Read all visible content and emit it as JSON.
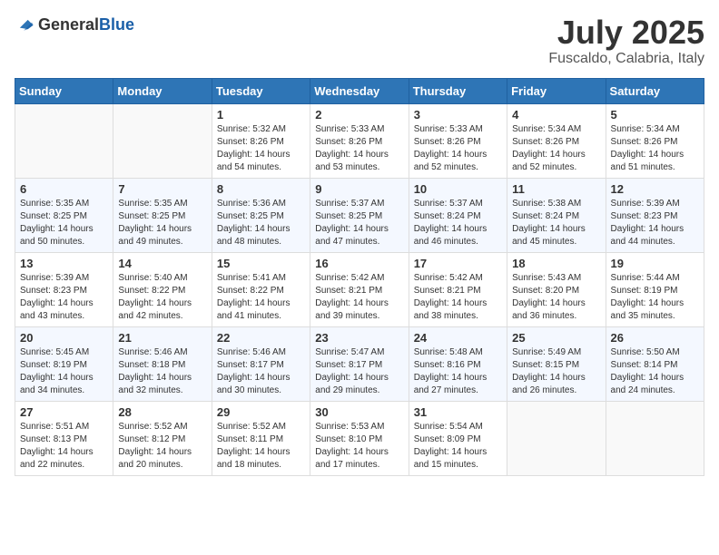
{
  "header": {
    "logo_general": "General",
    "logo_blue": "Blue",
    "month_year": "July 2025",
    "location": "Fuscaldo, Calabria, Italy"
  },
  "weekdays": [
    "Sunday",
    "Monday",
    "Tuesday",
    "Wednesday",
    "Thursday",
    "Friday",
    "Saturday"
  ],
  "weeks": [
    [
      {
        "day": "",
        "sunrise": "",
        "sunset": "",
        "daylight": ""
      },
      {
        "day": "",
        "sunrise": "",
        "sunset": "",
        "daylight": ""
      },
      {
        "day": "1",
        "sunrise": "Sunrise: 5:32 AM",
        "sunset": "Sunset: 8:26 PM",
        "daylight": "Daylight: 14 hours and 54 minutes."
      },
      {
        "day": "2",
        "sunrise": "Sunrise: 5:33 AM",
        "sunset": "Sunset: 8:26 PM",
        "daylight": "Daylight: 14 hours and 53 minutes."
      },
      {
        "day": "3",
        "sunrise": "Sunrise: 5:33 AM",
        "sunset": "Sunset: 8:26 PM",
        "daylight": "Daylight: 14 hours and 52 minutes."
      },
      {
        "day": "4",
        "sunrise": "Sunrise: 5:34 AM",
        "sunset": "Sunset: 8:26 PM",
        "daylight": "Daylight: 14 hours and 52 minutes."
      },
      {
        "day": "5",
        "sunrise": "Sunrise: 5:34 AM",
        "sunset": "Sunset: 8:26 PM",
        "daylight": "Daylight: 14 hours and 51 minutes."
      }
    ],
    [
      {
        "day": "6",
        "sunrise": "Sunrise: 5:35 AM",
        "sunset": "Sunset: 8:25 PM",
        "daylight": "Daylight: 14 hours and 50 minutes."
      },
      {
        "day": "7",
        "sunrise": "Sunrise: 5:35 AM",
        "sunset": "Sunset: 8:25 PM",
        "daylight": "Daylight: 14 hours and 49 minutes."
      },
      {
        "day": "8",
        "sunrise": "Sunrise: 5:36 AM",
        "sunset": "Sunset: 8:25 PM",
        "daylight": "Daylight: 14 hours and 48 minutes."
      },
      {
        "day": "9",
        "sunrise": "Sunrise: 5:37 AM",
        "sunset": "Sunset: 8:25 PM",
        "daylight": "Daylight: 14 hours and 47 minutes."
      },
      {
        "day": "10",
        "sunrise": "Sunrise: 5:37 AM",
        "sunset": "Sunset: 8:24 PM",
        "daylight": "Daylight: 14 hours and 46 minutes."
      },
      {
        "day": "11",
        "sunrise": "Sunrise: 5:38 AM",
        "sunset": "Sunset: 8:24 PM",
        "daylight": "Daylight: 14 hours and 45 minutes."
      },
      {
        "day": "12",
        "sunrise": "Sunrise: 5:39 AM",
        "sunset": "Sunset: 8:23 PM",
        "daylight": "Daylight: 14 hours and 44 minutes."
      }
    ],
    [
      {
        "day": "13",
        "sunrise": "Sunrise: 5:39 AM",
        "sunset": "Sunset: 8:23 PM",
        "daylight": "Daylight: 14 hours and 43 minutes."
      },
      {
        "day": "14",
        "sunrise": "Sunrise: 5:40 AM",
        "sunset": "Sunset: 8:22 PM",
        "daylight": "Daylight: 14 hours and 42 minutes."
      },
      {
        "day": "15",
        "sunrise": "Sunrise: 5:41 AM",
        "sunset": "Sunset: 8:22 PM",
        "daylight": "Daylight: 14 hours and 41 minutes."
      },
      {
        "day": "16",
        "sunrise": "Sunrise: 5:42 AM",
        "sunset": "Sunset: 8:21 PM",
        "daylight": "Daylight: 14 hours and 39 minutes."
      },
      {
        "day": "17",
        "sunrise": "Sunrise: 5:42 AM",
        "sunset": "Sunset: 8:21 PM",
        "daylight": "Daylight: 14 hours and 38 minutes."
      },
      {
        "day": "18",
        "sunrise": "Sunrise: 5:43 AM",
        "sunset": "Sunset: 8:20 PM",
        "daylight": "Daylight: 14 hours and 36 minutes."
      },
      {
        "day": "19",
        "sunrise": "Sunrise: 5:44 AM",
        "sunset": "Sunset: 8:19 PM",
        "daylight": "Daylight: 14 hours and 35 minutes."
      }
    ],
    [
      {
        "day": "20",
        "sunrise": "Sunrise: 5:45 AM",
        "sunset": "Sunset: 8:19 PM",
        "daylight": "Daylight: 14 hours and 34 minutes."
      },
      {
        "day": "21",
        "sunrise": "Sunrise: 5:46 AM",
        "sunset": "Sunset: 8:18 PM",
        "daylight": "Daylight: 14 hours and 32 minutes."
      },
      {
        "day": "22",
        "sunrise": "Sunrise: 5:46 AM",
        "sunset": "Sunset: 8:17 PM",
        "daylight": "Daylight: 14 hours and 30 minutes."
      },
      {
        "day": "23",
        "sunrise": "Sunrise: 5:47 AM",
        "sunset": "Sunset: 8:17 PM",
        "daylight": "Daylight: 14 hours and 29 minutes."
      },
      {
        "day": "24",
        "sunrise": "Sunrise: 5:48 AM",
        "sunset": "Sunset: 8:16 PM",
        "daylight": "Daylight: 14 hours and 27 minutes."
      },
      {
        "day": "25",
        "sunrise": "Sunrise: 5:49 AM",
        "sunset": "Sunset: 8:15 PM",
        "daylight": "Daylight: 14 hours and 26 minutes."
      },
      {
        "day": "26",
        "sunrise": "Sunrise: 5:50 AM",
        "sunset": "Sunset: 8:14 PM",
        "daylight": "Daylight: 14 hours and 24 minutes."
      }
    ],
    [
      {
        "day": "27",
        "sunrise": "Sunrise: 5:51 AM",
        "sunset": "Sunset: 8:13 PM",
        "daylight": "Daylight: 14 hours and 22 minutes."
      },
      {
        "day": "28",
        "sunrise": "Sunrise: 5:52 AM",
        "sunset": "Sunset: 8:12 PM",
        "daylight": "Daylight: 14 hours and 20 minutes."
      },
      {
        "day": "29",
        "sunrise": "Sunrise: 5:52 AM",
        "sunset": "Sunset: 8:11 PM",
        "daylight": "Daylight: 14 hours and 18 minutes."
      },
      {
        "day": "30",
        "sunrise": "Sunrise: 5:53 AM",
        "sunset": "Sunset: 8:10 PM",
        "daylight": "Daylight: 14 hours and 17 minutes."
      },
      {
        "day": "31",
        "sunrise": "Sunrise: 5:54 AM",
        "sunset": "Sunset: 8:09 PM",
        "daylight": "Daylight: 14 hours and 15 minutes."
      },
      {
        "day": "",
        "sunrise": "",
        "sunset": "",
        "daylight": ""
      },
      {
        "day": "",
        "sunrise": "",
        "sunset": "",
        "daylight": ""
      }
    ]
  ]
}
